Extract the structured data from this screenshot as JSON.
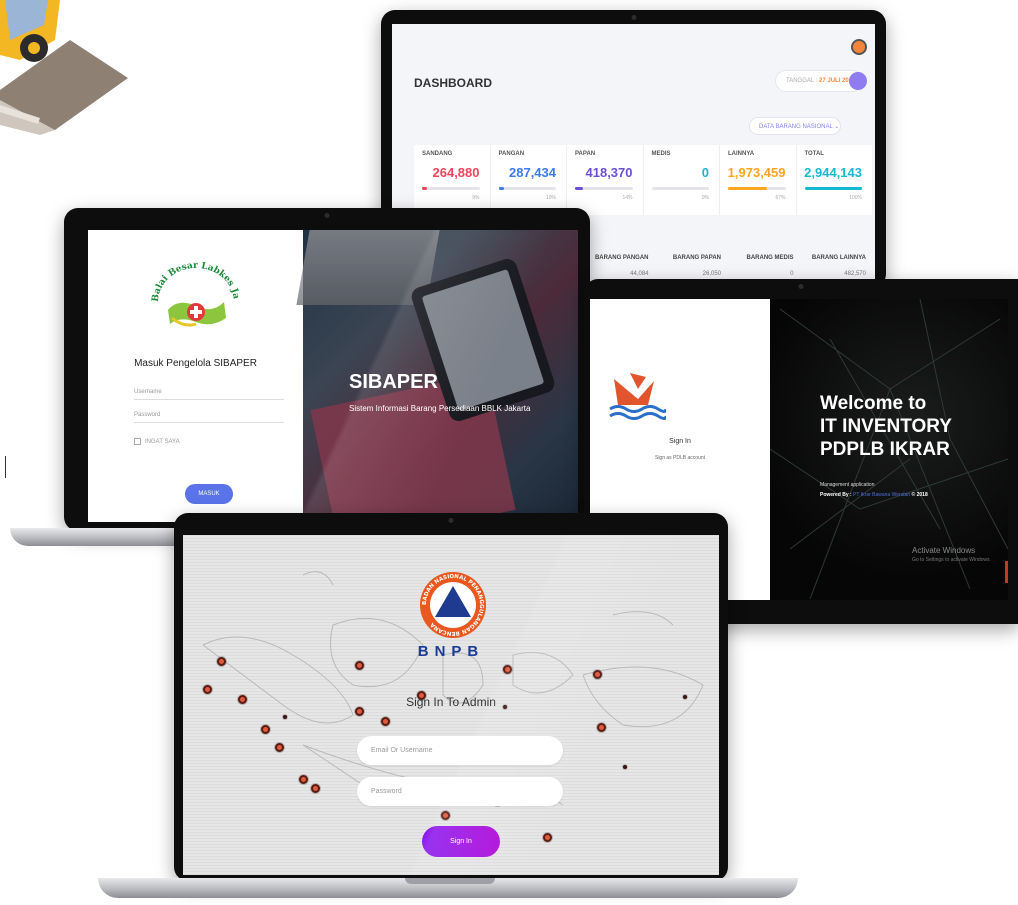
{
  "dashboard": {
    "title": "DASHBOARD",
    "date_prefix": "TANGGAL :",
    "date_value": "27 JULI 2018",
    "filter_label": "DATA BARANG NASIONAL",
    "stats": [
      {
        "label": "SANDANG",
        "value": "264,880",
        "pct": "9%",
        "fill_pct": 9,
        "color": "#f0445a"
      },
      {
        "label": "PANGAN",
        "value": "287,434",
        "pct": "10%",
        "fill_pct": 10,
        "color": "#3b7bea"
      },
      {
        "label": "PAPAN",
        "value": "418,370",
        "pct": "14%",
        "fill_pct": 14,
        "color": "#6b4fd8"
      },
      {
        "label": "MEDIS",
        "value": "0",
        "pct": "0%",
        "fill_pct": 0,
        "color": "#22b5c9"
      },
      {
        "label": "LAINNYA",
        "value": "1,973,459",
        "pct": "67%",
        "fill_pct": 67,
        "color": "#ffa51f"
      },
      {
        "label": "TOTAL",
        "value": "2,944,143",
        "pct": "100%",
        "fill_pct": 100,
        "color": "#17b9d2"
      }
    ],
    "table_headers": [
      "BARANG PANGAN",
      "BARANG PAPAN",
      "BARANG MEDIS",
      "BARANG LAINNYA"
    ],
    "table_row": [
      "44,084",
      "26,050",
      "0",
      "482,570"
    ]
  },
  "sibaper": {
    "logo_text": "Balai Besar Labkes Jakarta",
    "login_title": "Masuk Pengelola SIBAPER",
    "username_placeholder": "Username",
    "password_placeholder": "Password",
    "remember_label": "INGAT SAYA",
    "submit_label": "MASUK",
    "brand": "SIBAPER",
    "subtitle": "Sistem Informasi Barang Persediaan BBLK Jakarta"
  },
  "itinv": {
    "sign_in": "Sign In",
    "sign_in_sub": "Sign as PDLB account",
    "welcome_line1": "Welcome to",
    "welcome_line2": "IT INVENTORY",
    "welcome_line3": "PDPLB IKRAR",
    "mgmt": "Management application",
    "powered_prefix": "Powered By :",
    "powered_company": "PT Ikrar Bawana Wendan",
    "powered_suffix": "© 2018",
    "activate_title": "Activate Windows",
    "activate_sub": "Go to Settings to activate Windows."
  },
  "bnpb": {
    "logo_ring_text": "BADAN NASIONAL PENANGGULANGAN BENCANA",
    "name": "BNPB",
    "title": "Sign In To Admin",
    "email_placeholder": "Email Or Username",
    "password_placeholder": "Password",
    "submit_label": "Sign In"
  }
}
